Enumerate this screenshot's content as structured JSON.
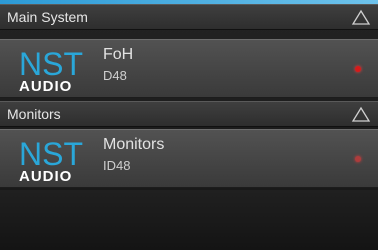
{
  "sections": [
    {
      "title": "Main System",
      "collapse_icon": "triangle-up-icon",
      "device": {
        "logo_text_top": "NST",
        "logo_text_bottom": "AUDIO",
        "name": "FoH",
        "model": "D48",
        "status_color": "#d61a1a"
      }
    },
    {
      "title": "Monitors",
      "collapse_icon": "triangle-up-icon",
      "device": {
        "logo_text_top": "NST",
        "logo_text_bottom": "AUDIO",
        "name": "Monitors",
        "model": "ID48",
        "status_color": "#c83a3a"
      }
    }
  ],
  "colors": {
    "accent": "#2c9ad6",
    "logo_blue": "#2aa7d9",
    "logo_white": "#ffffff"
  }
}
